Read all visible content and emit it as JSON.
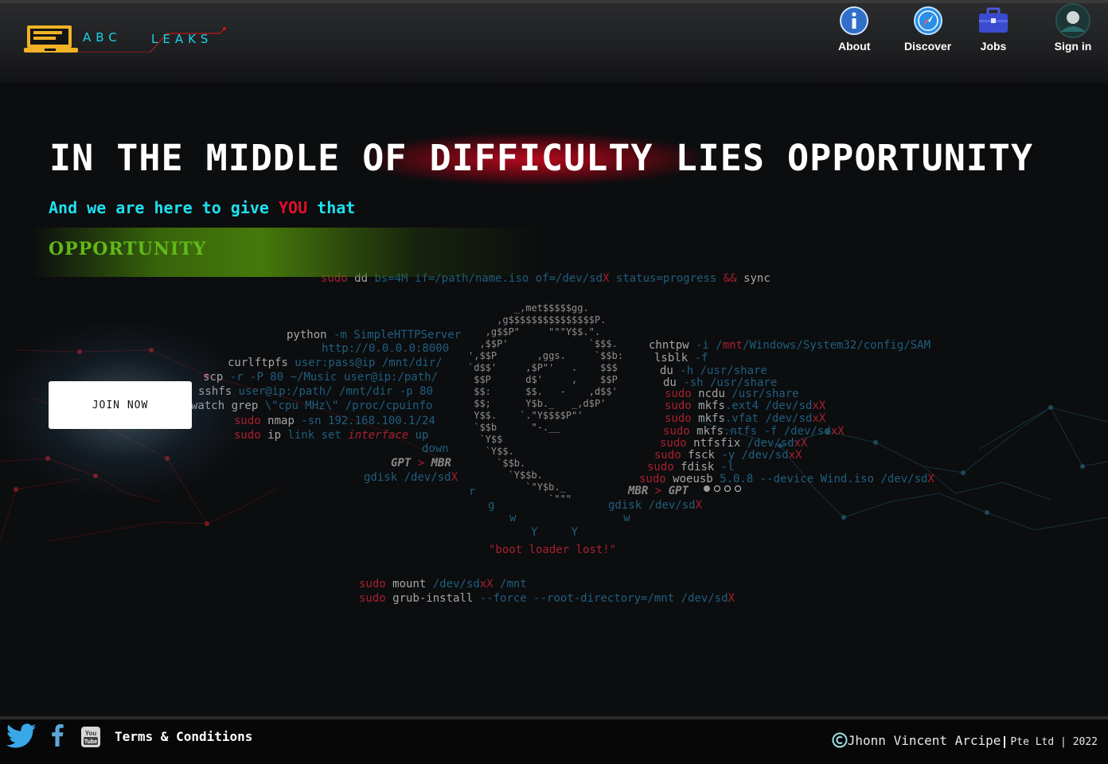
{
  "brand": {
    "name_left": "ABC",
    "name_right": "LEAKS"
  },
  "nav": [
    {
      "label": "About",
      "icon": "info-icon"
    },
    {
      "label": "Discover",
      "icon": "compass-icon"
    },
    {
      "label": "Jobs",
      "icon": "briefcase-icon"
    },
    {
      "label": "Sign in",
      "icon": "user-avatar-icon"
    }
  ],
  "hero": {
    "headline": "IN THE MIDDLE OF DIFFICULTY LIES OPPORTUNITY",
    "sub_before": "And we are here to give ",
    "sub_highlight": "YOU",
    "sub_after": " that",
    "opportunity": "OPPORTUNITY",
    "cta": "JOIN NOW"
  },
  "carousel": {
    "total": 4,
    "active": 0
  },
  "footer": {
    "terms": "Terms & Conditions",
    "copyright_name": "Jhonn Vincent Arcipe",
    "copyright_rest": "Pte Ltd | 2022",
    "social": [
      "twitter-icon",
      "facebook-icon",
      "youtube-icon"
    ]
  },
  "colors": {
    "accent_cyan": "#19d5e6",
    "accent_red": "#e0102a",
    "accent_green": "#62b818"
  }
}
